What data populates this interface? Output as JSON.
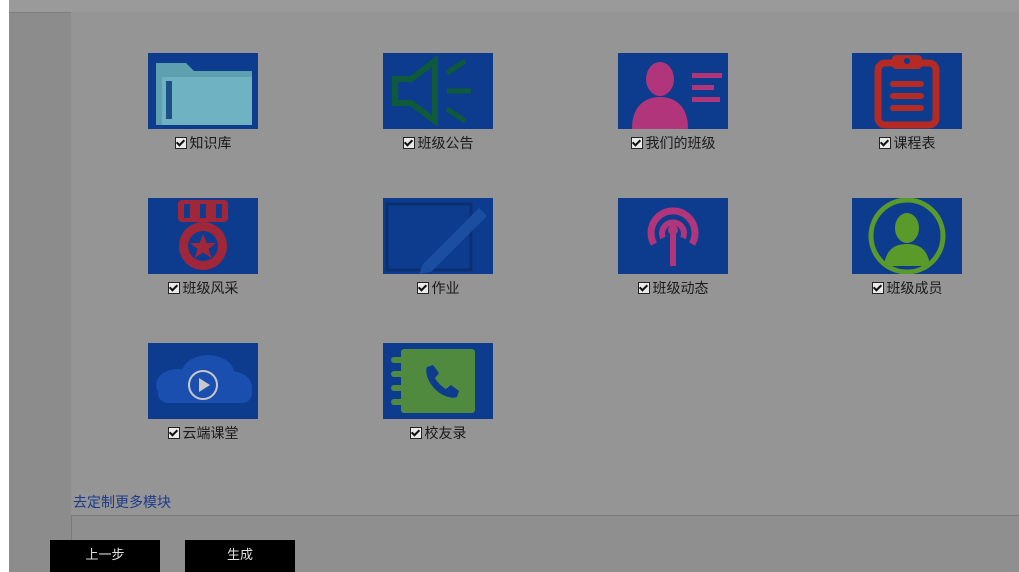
{
  "modules": [
    {
      "label": "知识库",
      "checked": true,
      "icon": "folder-icon"
    },
    {
      "label": "班级公告",
      "checked": true,
      "icon": "megaphone-icon"
    },
    {
      "label": "我们的班级",
      "checked": true,
      "icon": "profile-card-icon"
    },
    {
      "label": "课程表",
      "checked": true,
      "icon": "clipboard-icon"
    },
    {
      "label": "班级风采",
      "checked": true,
      "icon": "medal-icon"
    },
    {
      "label": "作业",
      "checked": true,
      "icon": "pencil-icon"
    },
    {
      "label": "班级动态",
      "checked": true,
      "icon": "broadcast-icon"
    },
    {
      "label": "班级成员",
      "checked": true,
      "icon": "member-icon"
    },
    {
      "label": "云端课堂",
      "checked": true,
      "icon": "cloud-play-icon"
    },
    {
      "label": "校友录",
      "checked": true,
      "icon": "address-book-icon"
    }
  ],
  "more_link": "去定制更多模块",
  "buttons": {
    "prev": "上一步",
    "generate": "生成"
  },
  "colors": {
    "tile_bg": "#0d3b8e",
    "overlay": "#959595"
  }
}
